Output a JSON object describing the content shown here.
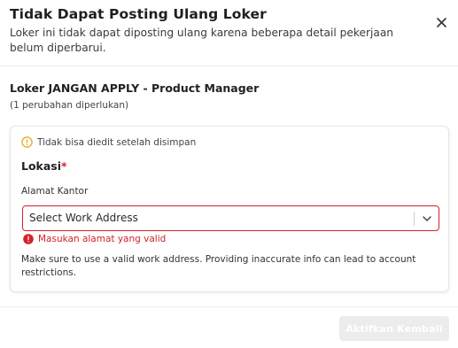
{
  "modal": {
    "title": "Tidak Dapat Posting Ulang Loker",
    "subtitle": "Loker ini tidak dapat diposting ulang karena beberapa detail pekerjaan belum diperbarui.",
    "close_icon": "close-icon"
  },
  "job": {
    "title": "Loker JANGAN APPLY - Product Manager",
    "changes_needed": "(1 perubahan diperlukan)"
  },
  "card": {
    "warning_icon": "warning-circle-icon",
    "warning_text": "Tidak bisa diedit setelah disimpan",
    "section_title": "Lokasi",
    "required_marker": "*",
    "field_label": "Alamat Kantor",
    "select": {
      "value": "Select Work Address",
      "chevron_icon": "chevron-down-icon"
    },
    "error": {
      "icon": "error-icon",
      "text": "Masukan alamat yang valid"
    },
    "help_text": "Make sure to use a valid work address. Providing inaccurate info can lead to account restrictions."
  },
  "footer": {
    "reactivate_label": "Aktifkan Kembali"
  },
  "colors": {
    "error": "#d1232b",
    "warning": "#e8a317",
    "button_disabled_bg": "#ececec"
  }
}
